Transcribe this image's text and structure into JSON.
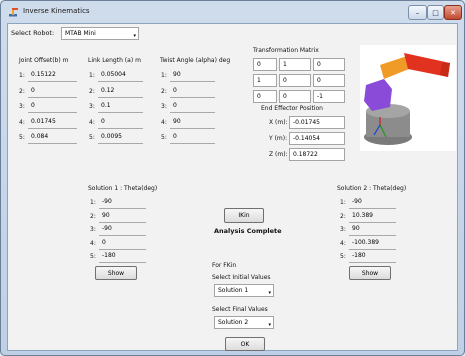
{
  "window": {
    "title": "Inverse Kinematics",
    "min_glyph": "–",
    "max_glyph": "□",
    "close_glyph": "✕"
  },
  "robot_select": {
    "label": "Select Robot:",
    "value": "MTAB Mini",
    "arrow": "▾"
  },
  "joint_offset": {
    "header": "Joint Offset(b) m",
    "rows": [
      {
        "idx": "1:",
        "val": "0.15122"
      },
      {
        "idx": "2:",
        "val": "0"
      },
      {
        "idx": "3:",
        "val": "0"
      },
      {
        "idx": "4:",
        "val": "0.01745"
      },
      {
        "idx": "5:",
        "val": "0.084"
      }
    ]
  },
  "link_length": {
    "header": "Link Length (a) m",
    "rows": [
      {
        "idx": "1:",
        "val": "0.05004"
      },
      {
        "idx": "2:",
        "val": "0.12"
      },
      {
        "idx": "3:",
        "val": "0.1"
      },
      {
        "idx": "4:",
        "val": "0"
      },
      {
        "idx": "5:",
        "val": "0.0095"
      }
    ]
  },
  "twist_angle": {
    "header": "Twist Angle (alpha) deg",
    "rows": [
      {
        "idx": "1:",
        "val": "90"
      },
      {
        "idx": "2:",
        "val": "0"
      },
      {
        "idx": "3:",
        "val": "0"
      },
      {
        "idx": "4:",
        "val": "90"
      },
      {
        "idx": "5:",
        "val": "0"
      }
    ]
  },
  "transform": {
    "header": "Transformation Matrix",
    "cells": [
      [
        "0",
        "1",
        "0"
      ],
      [
        "1",
        "0",
        "0"
      ],
      [
        "0",
        "0",
        "-1"
      ]
    ]
  },
  "end_effector": {
    "header": "End Effector Position",
    "x_label": "X (m):",
    "x": "-0.01745",
    "y_label": "Y (m):",
    "y": "-0.14054",
    "z_label": "Z (m):",
    "z": "0.18722"
  },
  "solution1": {
    "header": "Solution 1 : Theta(deg)",
    "rows": [
      {
        "idx": "1:",
        "val": "-90"
      },
      {
        "idx": "2:",
        "val": "90"
      },
      {
        "idx": "3:",
        "val": "-90"
      },
      {
        "idx": "4:",
        "val": "0"
      },
      {
        "idx": "5:",
        "val": "-180"
      }
    ],
    "show": "Show"
  },
  "solution2": {
    "header": "Solution 2 : Theta(deg)",
    "rows": [
      {
        "idx": "1:",
        "val": "-90"
      },
      {
        "idx": "2:",
        "val": "10.389"
      },
      {
        "idx": "3:",
        "val": "90"
      },
      {
        "idx": "4:",
        "val": "-100.389"
      },
      {
        "idx": "5:",
        "val": "-180"
      }
    ],
    "show": "Show"
  },
  "ikin_button": "IKin",
  "status": "Analysis Complete",
  "fkin": {
    "header": "For FKin",
    "initial_label": "Select Initial Values",
    "initial_value": "Solution 1",
    "final_label": "Select Final Values",
    "final_value": "Solution 2",
    "arrow": "▾",
    "ok": "OK"
  },
  "colors": {
    "robot_purple": "#8a4bd8",
    "robot_orange": "#f09a28",
    "robot_red": "#e0321e",
    "base_gray": "#8c8c8c"
  }
}
